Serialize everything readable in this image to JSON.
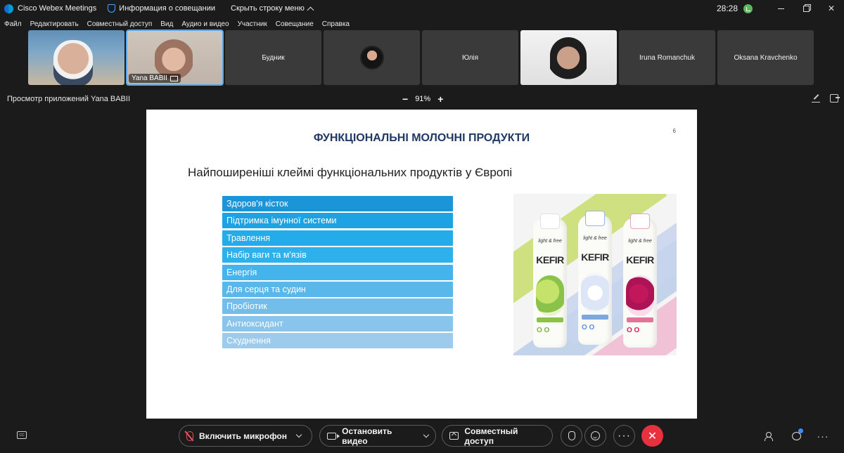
{
  "titlebar": {
    "app_name": "Cisco Webex Meetings",
    "meeting_info": "Информация о совещании",
    "hide_menu": "Скрыть строку меню",
    "clock": "28:28"
  },
  "menu": [
    "Файл",
    "Редактировать",
    "Совместный доступ",
    "Вид",
    "Аудио и видео",
    "Участник",
    "Совещание",
    "Справка"
  ],
  "participants": [
    {
      "name": "",
      "type": "video1"
    },
    {
      "name": "Yana BABII",
      "type": "video2",
      "active": true
    },
    {
      "name": "Будник",
      "type": "name"
    },
    {
      "name": "",
      "type": "avatar"
    },
    {
      "name": "Юлія",
      "type": "name"
    },
    {
      "name": "",
      "type": "video3"
    },
    {
      "name": "Iruna Romanchuk",
      "type": "name"
    },
    {
      "name": "Oksana Kravchenko",
      "type": "name"
    }
  ],
  "share": {
    "title": "Просмотр приложений Yana BABII",
    "zoom_minus": "−",
    "zoom_value": "91%",
    "zoom_plus": "+"
  },
  "slide": {
    "title": "ФУНКЦІОНАЛЬНІ МОЛОЧНІ ПРОДУКТИ",
    "number": "6",
    "subtitle": "Найпоширеніші клеймі функціональних продуктів у Європі",
    "items": [
      {
        "label": "Здоров'я кісток",
        "color": "#1b95d8"
      },
      {
        "label": "Підтримка імунної системи",
        "color": "#1da2e3"
      },
      {
        "label": "Травлення",
        "color": "#23abea"
      },
      {
        "label": "Набір ваги та м'язів",
        "color": "#2eb0ec"
      },
      {
        "label": "Енергія",
        "color": "#45b3ec"
      },
      {
        "label": "Для серця та судин",
        "color": "#5ab7ea"
      },
      {
        "label": "Пробіотик",
        "color": "#72bdea"
      },
      {
        "label": "Антиоксидант",
        "color": "#88c4eb"
      },
      {
        "label": "Схуднення",
        "color": "#9ccbed"
      }
    ],
    "product": {
      "brand": "light & free",
      "name": "KEFIR",
      "zeros": "O O"
    }
  },
  "controls": {
    "mic": "Включить микрофон",
    "video": "Остановить видео",
    "share": "Совместный доступ",
    "more": "···",
    "end": "✕"
  },
  "colors": {
    "accent": "#5aa7e8",
    "end_call": "#e8303f",
    "slide_title": "#1f3864"
  }
}
